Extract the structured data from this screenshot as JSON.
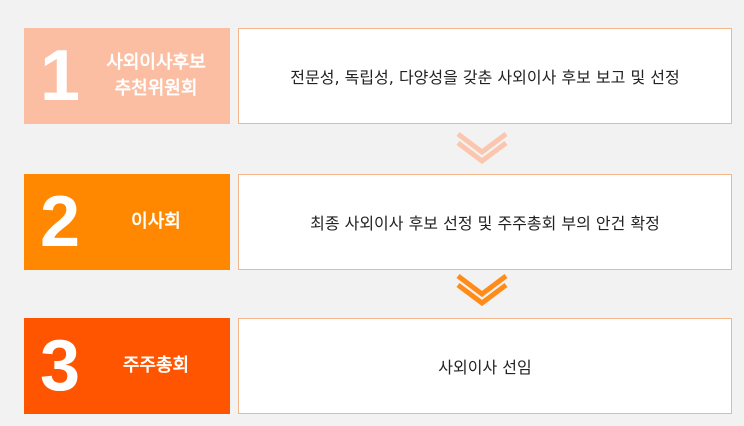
{
  "colors": {
    "step1_bg": "#fbbea2",
    "step2_bg": "#ff8800",
    "step3_bg": "#ff5500",
    "chevron1": "#fbc6ae",
    "chevron2": "#ff8c1a",
    "desc_border": "#f5b58a"
  },
  "steps": [
    {
      "number": "1",
      "label_lines": [
        "사외이사후보",
        "추천위원회"
      ],
      "description": "전문성, 독립성, 다양성을 갖춘 사외이사 후보 보고 및 선정"
    },
    {
      "number": "2",
      "label_lines": [
        "이사회"
      ],
      "description": "최종 사외이사 후보 선정 및 주주총회 부의 안건 확정"
    },
    {
      "number": "3",
      "label_lines": [
        "주주총회"
      ],
      "description": "사외이사 선임"
    }
  ],
  "icons": [
    "chevron-down-icon",
    "chevron-down-icon"
  ]
}
